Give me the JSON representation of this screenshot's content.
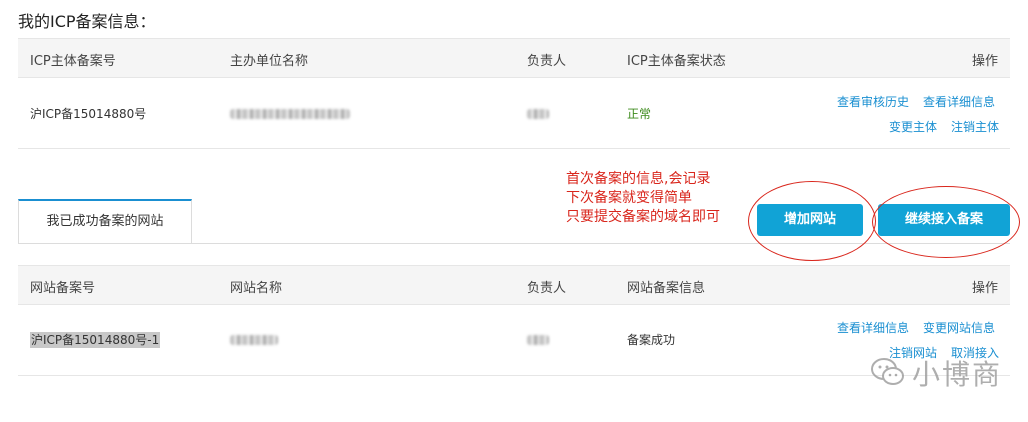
{
  "page_title": "我的ICP备案信息：",
  "icp_table": {
    "headers": [
      "ICP主体备案号",
      "主办单位名称",
      "负责人",
      "ICP主体备案状态",
      "操作"
    ],
    "row": {
      "icp_number": "沪ICP备15014880号",
      "status": "正常",
      "actions": [
        "查看审核历史",
        "查看详细信息",
        "变更主体",
        "注销主体"
      ]
    }
  },
  "tab": {
    "label": "我已成功备案的网站"
  },
  "buttons": {
    "add_site": "增加网站",
    "continue_filing": "继续接入备案"
  },
  "annotation": {
    "lines": [
      "首次备案的信息,会记录",
      "下次备案就变得简单",
      "只要提交备案的域名即可"
    ],
    "color": "#d9261c"
  },
  "site_table": {
    "headers": [
      "网站备案号",
      "网站名称",
      "负责人",
      "网站备案信息",
      "操作"
    ],
    "row": {
      "site_number": "沪ICP备15014880号-1",
      "info": "备案成功",
      "actions": [
        "查看详细信息",
        "变更网站信息",
        "注销网站",
        "取消接入"
      ]
    }
  },
  "watermark": {
    "text": "小博商",
    "icon": "wechat-icon"
  },
  "colors": {
    "link": "#1a8fd1",
    "button": "#11a3d6",
    "status_ok": "#3d8b1c",
    "annotation": "#d9261c"
  }
}
